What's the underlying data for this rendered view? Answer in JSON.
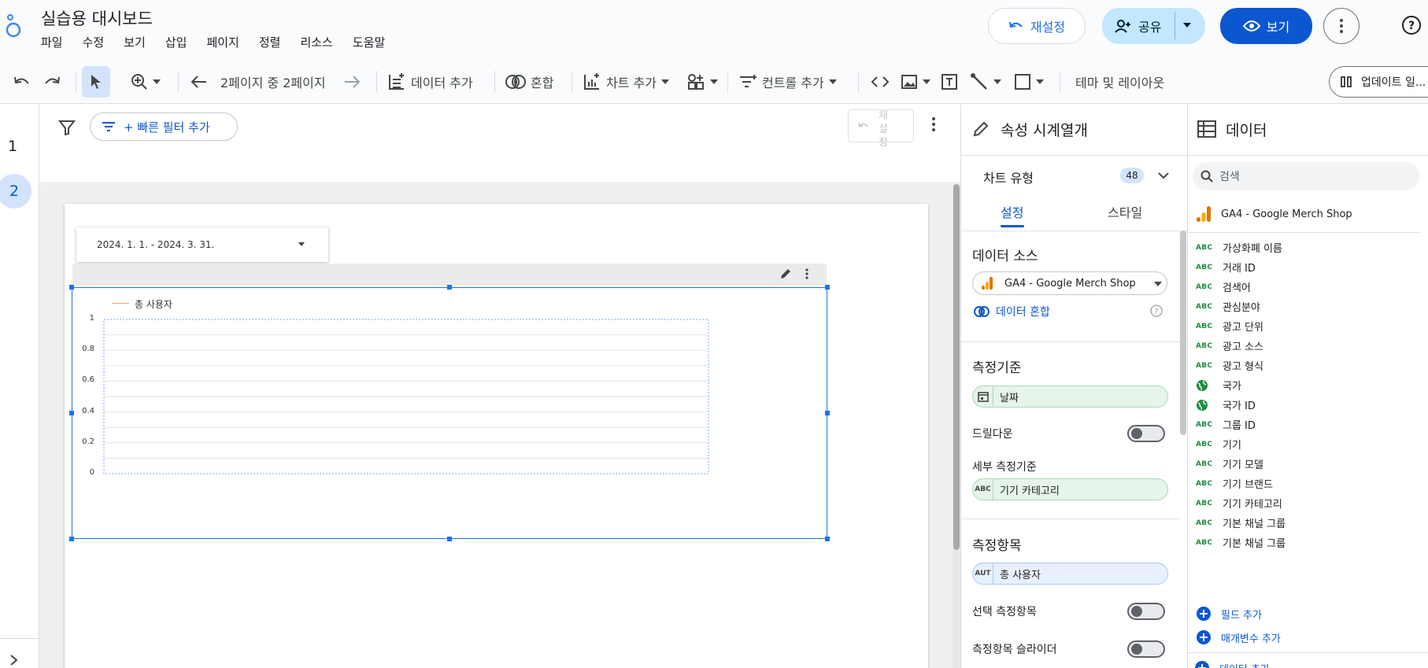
{
  "header": {
    "title": "실습용 대시보드",
    "menu": [
      "파일",
      "수정",
      "보기",
      "삽입",
      "페이지",
      "정렬",
      "리소스",
      "도움말"
    ],
    "reset_label": "재설정",
    "share_label": "공유",
    "view_label": "보기"
  },
  "toolbar": {
    "page_indicator": "2페이지 중 2페이지",
    "add_data": "데이터 추가",
    "blend": "혼합",
    "add_chart": "차트 추가",
    "add_control": "컨트롤 추가",
    "theme_layout": "테마 및 레이아웃",
    "update_label": "업데이트 일..."
  },
  "pages": [
    "1",
    "2"
  ],
  "filter_bar": {
    "quick_filter": "+ 빠른 필터 추가",
    "reset_vertical": "재 설 정"
  },
  "canvas": {
    "date_range": "2024. 1. 1. - 2024. 3. 31.",
    "legend": "총 사용자",
    "y_ticks": [
      "1",
      "0.8",
      "0.6",
      "0.4",
      "0.2",
      "0"
    ]
  },
  "chart_data": {
    "type": "line",
    "series": [
      {
        "name": "총 사용자",
        "values": []
      }
    ],
    "ylim": [
      0,
      1
    ],
    "y_ticks": [
      0,
      0.2,
      0.4,
      0.6,
      0.8,
      1
    ],
    "grid": true,
    "legend": "top-left"
  },
  "properties": {
    "title": "속성 시계열개",
    "chart_type_label": "차트 유형",
    "chart_type_count": "48",
    "tab_setup": "설정",
    "tab_style": "스타일",
    "data_source_title": "데이터 소스",
    "data_source_value": "GA4 - Google Merch Shop",
    "blend_data": "데이터 혼합",
    "dimension_title": "측정기준",
    "dimension_value": "날짜",
    "drilldown": "드릴다운",
    "breakdown_title": "세부 측정기준",
    "breakdown_value": "기기 카테고리",
    "metric_title": "측정항목",
    "metric_value": "총 사용자",
    "optional_metrics": "선택 측정항목",
    "metric_slider": "측정항목 슬라이더"
  },
  "data_panel": {
    "title": "데이터",
    "search_placeholder": "검색",
    "source": "GA4 - Google Merch Shop",
    "fields": [
      {
        "type": "ABC",
        "name": "가상화폐 이름"
      },
      {
        "type": "ABC",
        "name": "거래 ID"
      },
      {
        "type": "ABC",
        "name": "검색어"
      },
      {
        "type": "ABC",
        "name": "관심분야"
      },
      {
        "type": "ABC",
        "name": "광고 단위"
      },
      {
        "type": "ABC",
        "name": "광고 소스"
      },
      {
        "type": "ABC",
        "name": "광고 형식"
      },
      {
        "type": "GEO",
        "name": "국가"
      },
      {
        "type": "GEO",
        "name": "국가 ID"
      },
      {
        "type": "ABC",
        "name": "그룹 ID"
      },
      {
        "type": "ABC",
        "name": "기기"
      },
      {
        "type": "ABC",
        "name": "기기 모델"
      },
      {
        "type": "ABC",
        "name": "기기 브랜드"
      },
      {
        "type": "ABC",
        "name": "기기 카테고리"
      },
      {
        "type": "ABC",
        "name": "기본 채널 그룹"
      },
      {
        "type": "ABC",
        "name": "기본 채널 그룹"
      }
    ],
    "add_field": "필드 추가",
    "add_parameter": "매개변수 추가",
    "add_data": "데이터 추가"
  },
  "colors": {
    "accent": "#1a73e8",
    "share_bg": "#c2e7ff",
    "dimension_chip": "#e6f4ea",
    "metric_chip": "#e8f0fe",
    "series_line": "#f4a460"
  }
}
